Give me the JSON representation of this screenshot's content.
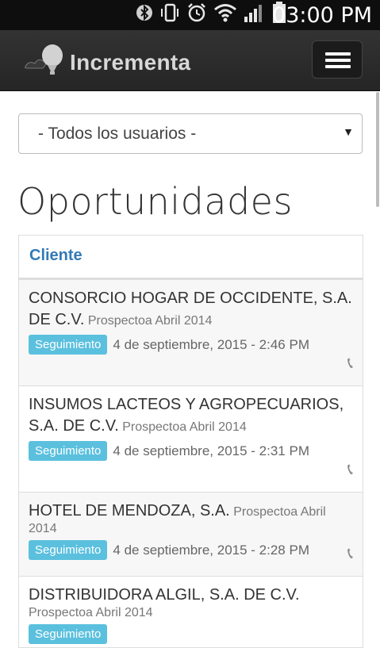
{
  "status_bar": {
    "time": "03:00 PM",
    "icons": [
      "bluetooth-icon",
      "vibrate-icon",
      "alarm-icon",
      "wifi-icon",
      "signal-icon",
      "battery-icon"
    ]
  },
  "navbar": {
    "brand": "Incrementa",
    "menu_icon": "hamburger-icon"
  },
  "filter": {
    "selected": "- Todos los usuarios -"
  },
  "page": {
    "title": "Oportunidades"
  },
  "table": {
    "header": "Cliente",
    "rows": [
      {
        "client": "CONSORCIO HOGAR DE OCCIDENTE, S.A. DE C.V.",
        "source": "Prospectoa Abril 2014",
        "status": "Seguimiento",
        "date": "4 de septiembre, 2015 - 2:46 PM"
      },
      {
        "client": "INSUMOS LACTEOS Y AGROPECUARIOS, S.A. DE C.V.",
        "source": "Prospectoa Abril 2014",
        "status": "Seguimiento",
        "date": "4 de septiembre, 2015 - 2:31 PM"
      },
      {
        "client": "HOTEL DE MENDOZA, S.A.",
        "source": "Prospectoa Abril 2014",
        "status": "Seguimiento",
        "date": "4 de septiembre, 2015 - 2:28 PM"
      },
      {
        "client": "DISTRIBUIDORA ALGIL, S.A. DE C.V.",
        "source": "Prospectoa Abril 2014",
        "status": "Seguimiento",
        "date": ""
      }
    ]
  },
  "colors": {
    "link": "#337ab7",
    "badge": "#5bc0de",
    "navbar": "#2b2b2b"
  }
}
